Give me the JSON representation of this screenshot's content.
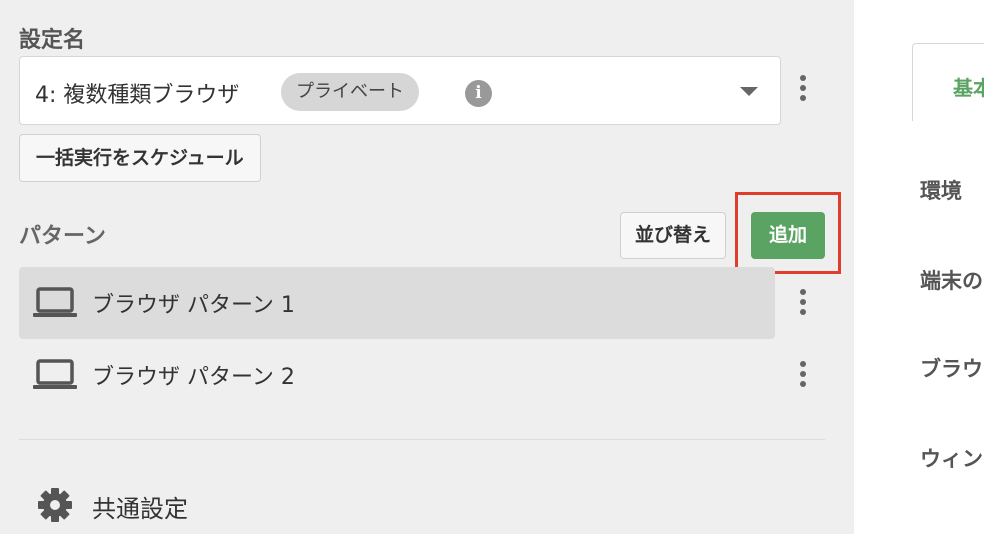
{
  "settings": {
    "label": "設定名",
    "selected_name": "4: 複数種類ブラウザ",
    "badge": "プライベート",
    "schedule_button": "一括実行をスケジュール"
  },
  "patterns": {
    "label": "パターン",
    "sort_button": "並び替え",
    "add_button": "追加",
    "items": [
      {
        "label": "ブラウザ パターン 1",
        "selected": true
      },
      {
        "label": "ブラウザ パターン 2",
        "selected": false
      }
    ]
  },
  "common_settings": {
    "label": "共通設定"
  },
  "right_panel": {
    "tab_label": "基本",
    "labels": [
      "環境",
      "端末の",
      "ブラウ",
      "ウィン"
    ]
  },
  "colors": {
    "accent_green": "#5aa362",
    "highlight_red": "#e03e2d",
    "panel_bg": "#efefef"
  },
  "icons": {
    "info": "info-icon",
    "dropdown": "chevron-down-icon",
    "more": "more-vertical-icon",
    "pattern": "laptop-icon",
    "settings": "gear-icon"
  }
}
